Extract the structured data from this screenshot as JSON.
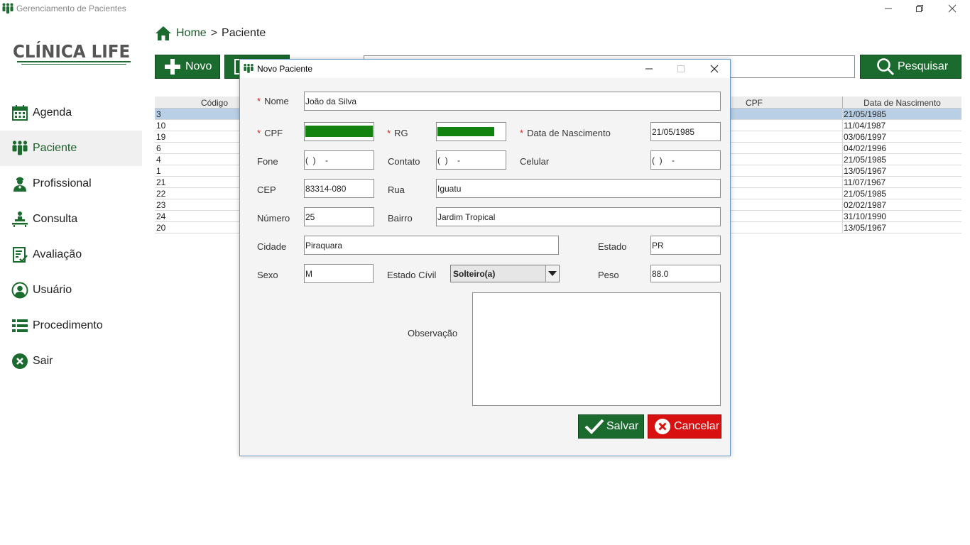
{
  "window": {
    "title": "Gerenciamento de Pacientes"
  },
  "sidebar": {
    "logo": "CLÍNICA LIFE",
    "items": [
      {
        "label": "Agenda",
        "icon": "calendar-icon"
      },
      {
        "label": "Paciente",
        "icon": "patients-icon",
        "active": true
      },
      {
        "label": "Profissional",
        "icon": "professional-icon"
      },
      {
        "label": "Consulta",
        "icon": "consultation-icon"
      },
      {
        "label": "Avaliação",
        "icon": "evaluation-icon"
      },
      {
        "label": "Usuário",
        "icon": "user-icon"
      },
      {
        "label": "Procedimento",
        "icon": "list-icon"
      },
      {
        "label": "Sair",
        "icon": "close-circle-icon"
      }
    ]
  },
  "breadcrumb": {
    "home": "Home",
    "separator": ">",
    "current": "Paciente"
  },
  "toolbar": {
    "new_label": "Novo",
    "search_label": "Pesquisar",
    "search_value": ""
  },
  "table": {
    "columns": [
      "Código",
      "CPF",
      "Data de Nascimento"
    ],
    "rows": [
      {
        "code": "3",
        "date": "21/05/1985",
        "selected": true
      },
      {
        "code": "10",
        "date": "11/04/1987"
      },
      {
        "code": "19",
        "date": "03/06/1997"
      },
      {
        "code": "6",
        "date": "04/02/1996"
      },
      {
        "code": "4",
        "date": "21/05/1985"
      },
      {
        "code": "1",
        "date": "13/05/1967"
      },
      {
        "code": "21",
        "date": "11/07/1967"
      },
      {
        "code": "22",
        "date": "21/05/1985"
      },
      {
        "code": "23",
        "date": "02/02/1987"
      },
      {
        "code": "24",
        "date": "31/10/1990"
      },
      {
        "code": "20",
        "date": "13/05/1967"
      }
    ]
  },
  "dialog": {
    "title": "Novo Paciente",
    "required_mark": "*",
    "labels": {
      "nome": "Nome",
      "cpf": "CPF",
      "rg": "RG",
      "nascimento": "Data de Nascimento",
      "fone": "Fone",
      "contato": "Contato",
      "celular": "Celular",
      "cep": "CEP",
      "rua": "Rua",
      "numero": "Número",
      "bairro": "Bairro",
      "cidade": "Cidade",
      "estado": "Estado",
      "sexo": "Sexo",
      "estado_civil": "Estado Cívil",
      "peso": "Peso",
      "observacao": "Observação"
    },
    "values": {
      "nome": "João da Silva",
      "nascimento": "21/05/1985",
      "fone": "(  )    -",
      "contato": "(  )    -",
      "celular": "(  )    -",
      "cep": "83314-080",
      "rua": "Iguatu",
      "numero": "25",
      "bairro": "Jardim Tropical",
      "cidade": "Piraquara",
      "estado": "PR",
      "sexo": "M",
      "estado_civil": "Solteiro(a)",
      "peso": "88.0",
      "observacao": ""
    },
    "save_label": "Salvar",
    "cancel_label": "Cancelar"
  },
  "colors": {
    "brand_green": "#1b6b2e",
    "cancel_red": "#d81010",
    "selection_blue": "#b8cfe5",
    "masked_field_green": "#12830f"
  }
}
